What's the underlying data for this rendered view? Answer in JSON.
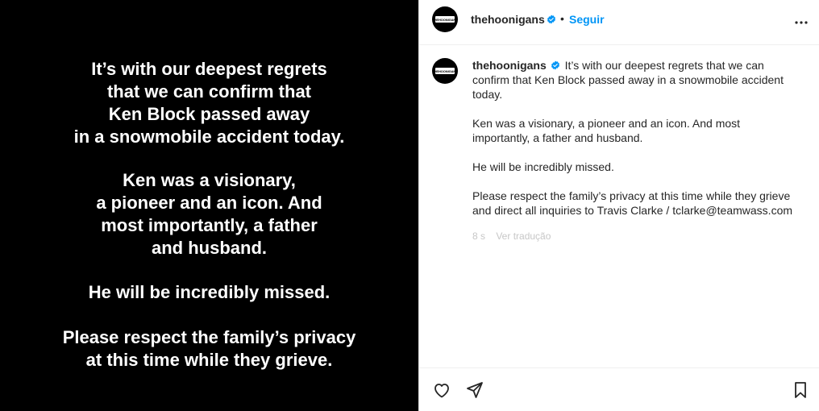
{
  "image_text": {
    "paragraphs": [
      [
        "It’s with our deepest regrets",
        "that we can confirm that",
        "Ken Block passed away",
        "in a snowmobile accident today."
      ],
      [
        "Ken was a visionary,",
        "a pioneer and an icon. And",
        "most importantly, a father",
        "and husband."
      ],
      [
        "He will be incredibly missed."
      ],
      [
        "Please respect the family’s privacy",
        "at this time while they grieve."
      ]
    ]
  },
  "header": {
    "avatar_logo": "THEHOONIGANS",
    "username": "thehoonigans",
    "separator": "•",
    "follow_label": "Seguir"
  },
  "caption": {
    "username": "thehoonigans",
    "first_text": "It’s with our deepest regrets that we can confirm that Ken Block passed away in a snowmobile accident today.",
    "paragraphs": [
      "Ken was a visionary, a pioneer and an icon. And most importantly, a father and husband.",
      "He will be incredibly missed.",
      "Please respect the family’s privacy at this time while they grieve and direct all inquiries to Travis Clarke / tclarke@teamwass.com"
    ],
    "faded_meta": "8 s    Ver tradução"
  },
  "icons": {
    "verified": "verified-badge-icon",
    "more": "more-options-icon",
    "like": "heart-icon",
    "share": "share-icon",
    "save": "bookmark-icon"
  },
  "colors": {
    "accent": "#0095f6",
    "text": "#262626",
    "image_bg": "#000000",
    "verified": "#0095f6"
  }
}
